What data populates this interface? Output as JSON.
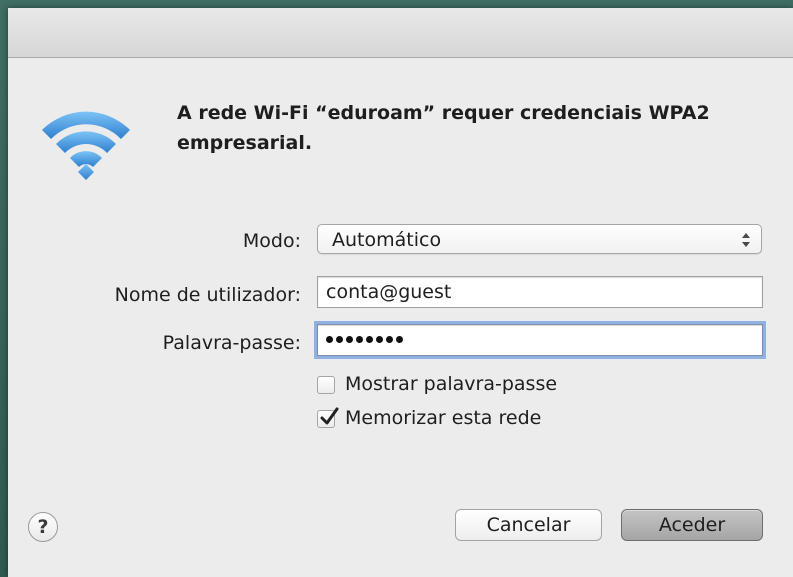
{
  "dialog": {
    "heading": "A rede Wi‑Fi “eduroam” requer credenciais WPA2 empresarial."
  },
  "form": {
    "mode_label": "Modo:",
    "mode_value": "Automático",
    "username_label": "Nome de utilizador:",
    "username_value": "conta@guest",
    "password_label": "Palavra-passe:",
    "password_masked": "••••••••",
    "show_password_label": "Mostrar palavra-passe",
    "show_password_checked": false,
    "remember_label": "Memorizar esta rede",
    "remember_checked": true
  },
  "buttons": {
    "help": "?",
    "cancel": "Cancelar",
    "ok": "Aceder"
  },
  "icons": {
    "wifi": "wifi-icon",
    "select_arrows": "up-down-arrows-icon",
    "checkmark": "checkmark-icon"
  },
  "colors": {
    "wifi_blue": "#4a9fe3",
    "dialog_bg": "#ececec",
    "focus_ring": "#8fb0e0",
    "default_button": "#b4b4b4"
  }
}
